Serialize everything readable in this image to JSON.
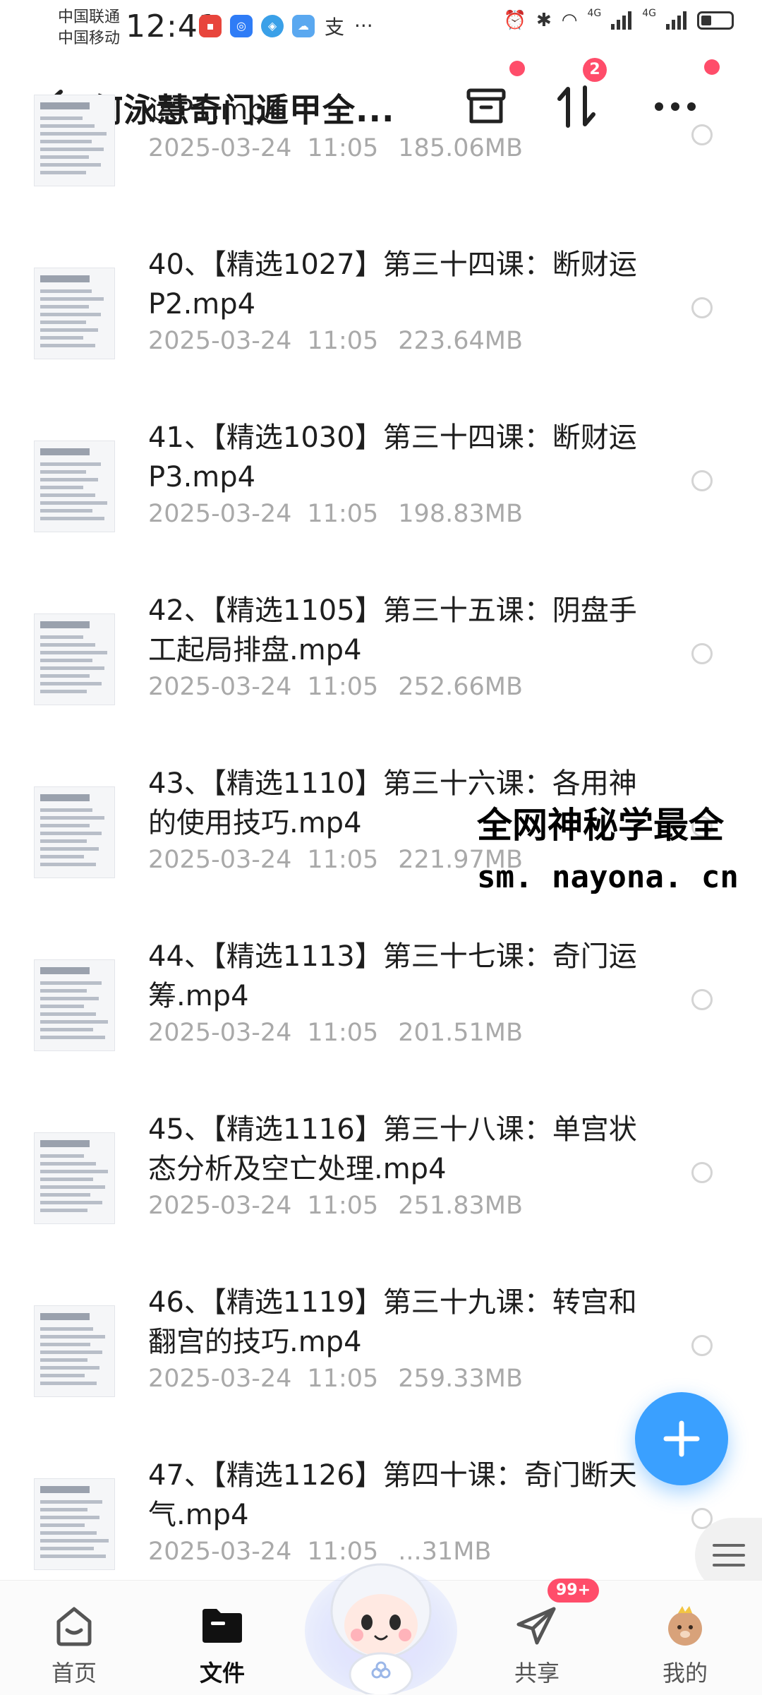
{
  "status_bar": {
    "carrier1": "中国联通",
    "carrier2": "中国移动",
    "time": "12:41",
    "net1": "4G",
    "net2": "4G",
    "app_icons": [
      "huawei-icon",
      "blue-app-icon",
      "browser-icon",
      "weather-icon",
      "alipay-icon"
    ],
    "more": "···",
    "battery_level": 0.35
  },
  "header": {
    "title": "何泳慧奇门遁甲全...",
    "sort_badge": "2"
  },
  "files": [
    {
      "name": "运P1.mp4",
      "date": "2025-03-24",
      "time": "11:05",
      "size": "185.06MB"
    },
    {
      "name": "40、【精选1027】第三十四课：断财运P2.mp4",
      "date": "2025-03-24",
      "time": "11:05",
      "size": "223.64MB"
    },
    {
      "name": "41、【精选1030】第三十四课：断财运P3.mp4",
      "date": "2025-03-24",
      "time": "11:05",
      "size": "198.83MB"
    },
    {
      "name": "42、【精选1105】第三十五课：阴盘手工起局排盘.mp4",
      "date": "2025-03-24",
      "time": "11:05",
      "size": "252.66MB"
    },
    {
      "name": "43、【精选1110】第三十六课：各用神的使用技巧.mp4",
      "date": "2025-03-24",
      "time": "11:05",
      "size": "221.97MB"
    },
    {
      "name": "44、【精选1113】第三十七课：奇门运筹.mp4",
      "date": "2025-03-24",
      "time": "11:05",
      "size": "201.51MB"
    },
    {
      "name": "45、【精选1116】第三十八课：单宫状态分析及空亡处理.mp4",
      "date": "2025-03-24",
      "time": "11:05",
      "size": "251.83MB"
    },
    {
      "name": "46、【精选1119】第三十九课：转宫和翻宫的技巧.mp4",
      "date": "2025-03-24",
      "time": "11:05",
      "size": "259.33MB"
    },
    {
      "name": "47、【精选1126】第四十课：奇门断天气.mp4",
      "date": "2025-03-24",
      "time": "11:05",
      "size": "...31MB"
    }
  ],
  "watermark": {
    "line1": "全网神秘学最全",
    "line2": "sm. nayona. cn"
  },
  "bottom_nav": [
    {
      "label": "首页",
      "icon": "home-icon"
    },
    {
      "label": "文件",
      "icon": "folder-icon"
    },
    {
      "label": "共享",
      "icon": "share-plane-icon"
    },
    {
      "label": "我的",
      "icon": "profile-avatar-icon"
    }
  ],
  "share_badge": "99+",
  "colors": {
    "accent": "#3aa0ff",
    "badge": "#ff4d6a",
    "meta_text": "#a9a9a9"
  }
}
